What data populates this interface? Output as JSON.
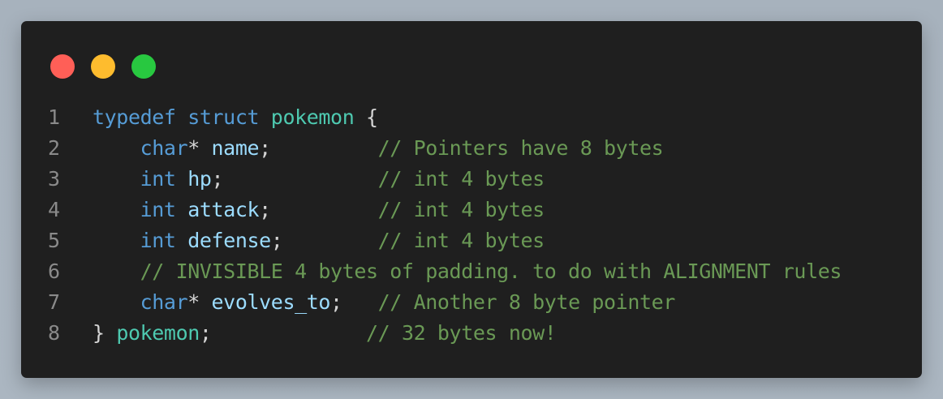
{
  "window": {
    "traffic_lights": [
      {
        "name": "close",
        "color": "#ff5f57"
      },
      {
        "name": "minimize",
        "color": "#febc2e"
      },
      {
        "name": "maximize",
        "color": "#28c840"
      }
    ]
  },
  "code": {
    "lines": [
      {
        "num": "1",
        "segments": [
          {
            "t": "typedef",
            "c": "kw"
          },
          {
            "t": " ",
            "c": "pun"
          },
          {
            "t": "struct",
            "c": "kw"
          },
          {
            "t": " ",
            "c": "pun"
          },
          {
            "t": "pokemon",
            "c": "ty"
          },
          {
            "t": " {",
            "c": "pun"
          }
        ]
      },
      {
        "num": "2",
        "segments": [
          {
            "t": "    ",
            "c": "pun"
          },
          {
            "t": "char",
            "c": "kw"
          },
          {
            "t": "* ",
            "c": "pun"
          },
          {
            "t": "name",
            "c": "var"
          },
          {
            "t": ";         ",
            "c": "pun"
          },
          {
            "t": "// Pointers have 8 bytes",
            "c": "com"
          }
        ]
      },
      {
        "num": "3",
        "segments": [
          {
            "t": "    ",
            "c": "pun"
          },
          {
            "t": "int",
            "c": "kw"
          },
          {
            "t": " ",
            "c": "pun"
          },
          {
            "t": "hp",
            "c": "var"
          },
          {
            "t": ";             ",
            "c": "pun"
          },
          {
            "t": "// int 4 bytes",
            "c": "com"
          }
        ]
      },
      {
        "num": "4",
        "segments": [
          {
            "t": "    ",
            "c": "pun"
          },
          {
            "t": "int",
            "c": "kw"
          },
          {
            "t": " ",
            "c": "pun"
          },
          {
            "t": "attack",
            "c": "var"
          },
          {
            "t": ";         ",
            "c": "pun"
          },
          {
            "t": "// int 4 bytes",
            "c": "com"
          }
        ]
      },
      {
        "num": "5",
        "segments": [
          {
            "t": "    ",
            "c": "pun"
          },
          {
            "t": "int",
            "c": "kw"
          },
          {
            "t": " ",
            "c": "pun"
          },
          {
            "t": "defense",
            "c": "var"
          },
          {
            "t": ";        ",
            "c": "pun"
          },
          {
            "t": "// int 4 bytes",
            "c": "com"
          }
        ]
      },
      {
        "num": "6",
        "segments": [
          {
            "t": "    ",
            "c": "pun"
          },
          {
            "t": "// INVISIBLE 4 bytes of padding. to do with ALIGNMENT rules",
            "c": "com"
          }
        ]
      },
      {
        "num": "7",
        "segments": [
          {
            "t": "    ",
            "c": "pun"
          },
          {
            "t": "char",
            "c": "kw"
          },
          {
            "t": "* ",
            "c": "pun"
          },
          {
            "t": "evolves_to",
            "c": "var"
          },
          {
            "t": ";   ",
            "c": "pun"
          },
          {
            "t": "// Another 8 byte pointer",
            "c": "com"
          }
        ]
      },
      {
        "num": "8",
        "segments": [
          {
            "t": "} ",
            "c": "pun"
          },
          {
            "t": "pokemon",
            "c": "ty"
          },
          {
            "t": ";             ",
            "c": "pun"
          },
          {
            "t": "// 32 bytes now!",
            "c": "com"
          }
        ]
      }
    ]
  }
}
